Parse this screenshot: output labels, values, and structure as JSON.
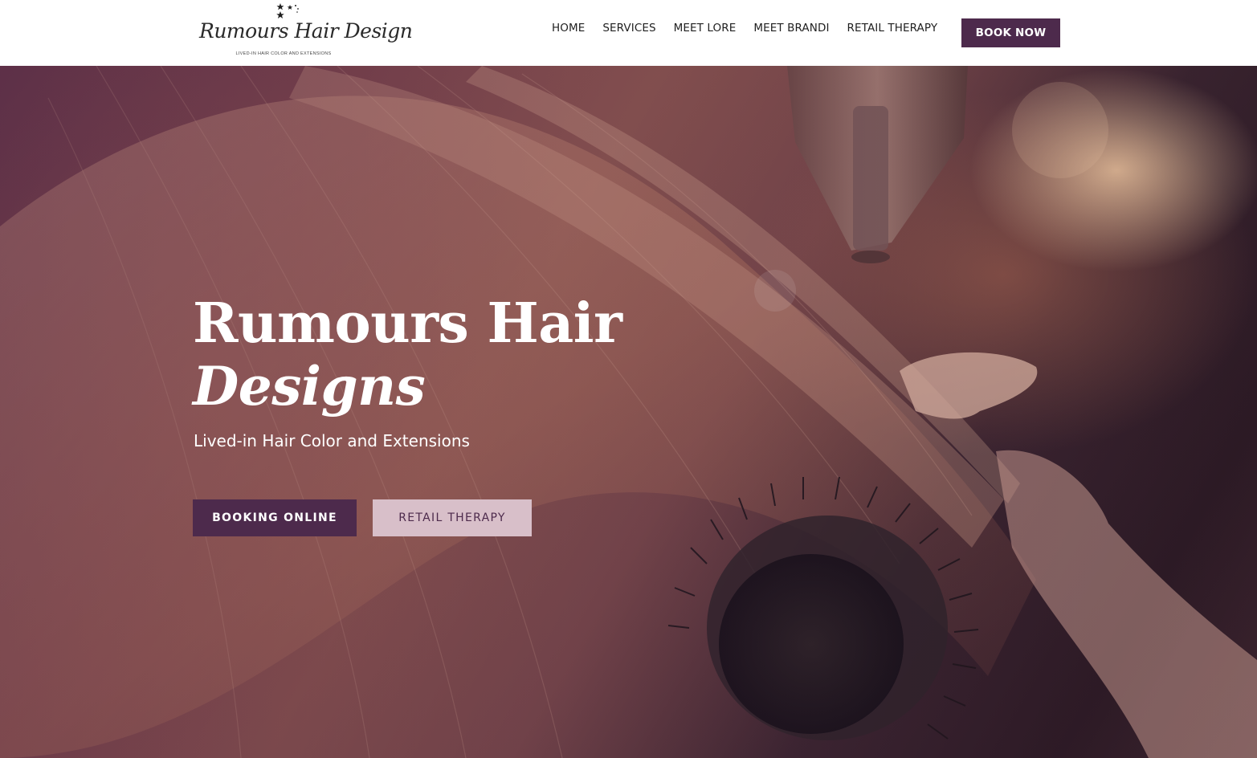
{
  "brand": {
    "logo_script": "Rumours Hair Design",
    "logo_tagline": "LIVED-IN HAIR COLOR AND EXTENSIONS"
  },
  "nav": {
    "items": [
      {
        "label": "HOME"
      },
      {
        "label": "SERVICES"
      },
      {
        "label": "MEET LORE"
      },
      {
        "label": "MEET BRANDI"
      },
      {
        "label": "RETAIL THERAPY"
      }
    ],
    "cta_label": "BOOK NOW"
  },
  "hero": {
    "title_line_1": "Rumours Hair",
    "title_line_2": "Designs",
    "subtitle": "Lived-in Hair Color and Extensions",
    "primary_button": "BOOKING ONLINE",
    "secondary_button": "RETAIL THERAPY",
    "background_image": "hair-salon-blowdry-photo"
  },
  "colors": {
    "brand_plum": "#4d2a4c",
    "secondary_button_bg": "#d8bfc9",
    "header_bg": "#ffffff"
  }
}
